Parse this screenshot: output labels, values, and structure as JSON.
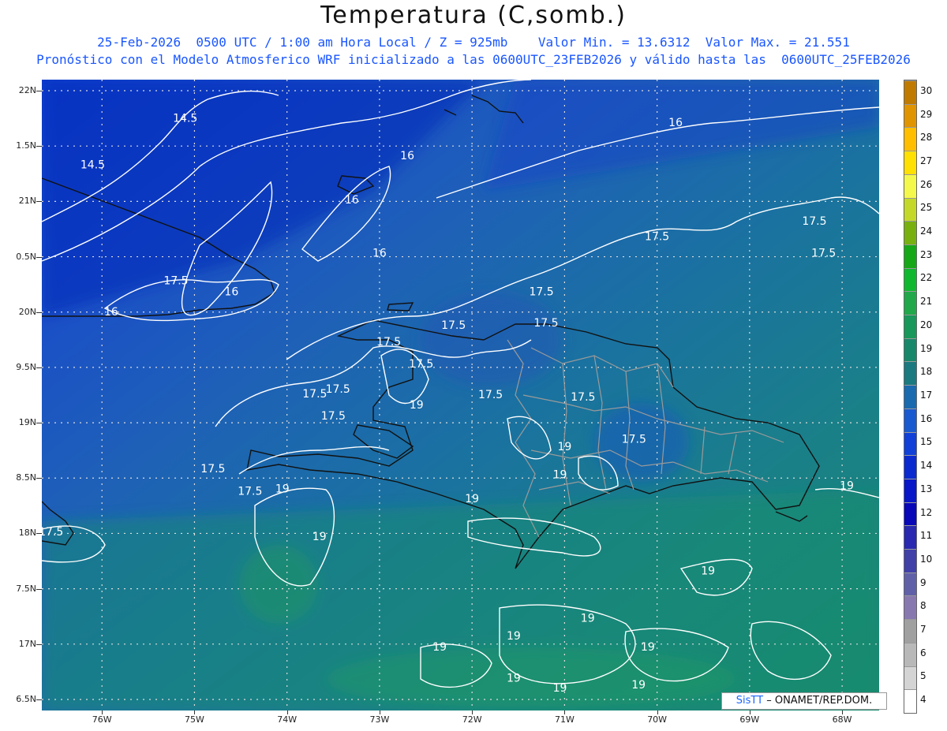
{
  "header": {
    "title": "Temperatura (C,somb.)",
    "line1": "25-Feb-2026  0500 UTC / 1:00 am Hora Local / Z = 925mb    Valor Min. = 13.6312  Valor Max. = 21.551",
    "line2": "Pronóstico con el Modelo Atmosferico WRF inicializado a las 0600UTC_23FEB2026 y válido hasta las  0600UTC_25FEB2026"
  },
  "axes": {
    "lat_labels": [
      "22N",
      "1.5N",
      "21N",
      "0.5N",
      "20N",
      "9.5N",
      "19N",
      "8.5N",
      "18N",
      "7.5N",
      "17N",
      "6.5N"
    ],
    "lat_values": [
      22,
      21.5,
      21,
      20.5,
      20,
      19.5,
      19,
      18.5,
      18,
      17.5,
      17,
      16.5
    ],
    "lon_labels": [
      "76W",
      "75W",
      "74W",
      "73W",
      "72W",
      "71W",
      "70W",
      "69W",
      "68W"
    ],
    "lon_values": [
      -76,
      -75,
      -74,
      -73,
      -72,
      -71,
      -70,
      -69,
      -68
    ],
    "lat_range": [
      16.4,
      22.1
    ],
    "lon_range": [
      -76.65,
      -67.6
    ]
  },
  "colorbar": {
    "labels": [
      "30",
      "29",
      "28",
      "27",
      "26",
      "25",
      "24",
      "23",
      "22",
      "21",
      "20",
      "19",
      "18",
      "17",
      "16",
      "15",
      "14",
      "13",
      "12",
      "11",
      "10",
      "9",
      "8",
      "7",
      "6",
      "5",
      "4"
    ],
    "colors": [
      "#c07a00",
      "#e09400",
      "#ffbe00",
      "#ffe000",
      "#f4f84a",
      "#c4d82a",
      "#78b010",
      "#16a816",
      "#10b830",
      "#20a84a",
      "#18985a",
      "#18886a",
      "#1a7a80",
      "#1a6ab0",
      "#1a5ad0",
      "#1040d8",
      "#0a2ad0",
      "#0818c8",
      "#0808b8",
      "#2828b0",
      "#4040a8",
      "#6060a8",
      "#8878b0",
      "#a0a0a0",
      "#b8b8b8",
      "#d4d4d4",
      "#ffffff"
    ]
  },
  "contours": {
    "labels": [
      {
        "text": "14.5",
        "lon": -75.1,
        "lat": 21.72
      },
      {
        "text": "14.5",
        "lon": -76.1,
        "lat": 21.3
      },
      {
        "text": "16",
        "lon": -73.3,
        "lat": 20.98
      },
      {
        "text": "16",
        "lon": -73.0,
        "lat": 20.5
      },
      {
        "text": "16",
        "lon": -74.6,
        "lat": 20.15
      },
      {
        "text": "16",
        "lon": -75.9,
        "lat": 19.97
      },
      {
        "text": "16",
        "lon": -72.7,
        "lat": 21.38
      },
      {
        "text": "16",
        "lon": -69.8,
        "lat": 21.68
      },
      {
        "text": "17.5",
        "lon": -70.0,
        "lat": 20.65
      },
      {
        "text": "17.5",
        "lon": -68.2,
        "lat": 20.5
      },
      {
        "text": "17.5",
        "lon": -68.3,
        "lat": 20.79
      },
      {
        "text": "17.5",
        "lon": -75.2,
        "lat": 20.25
      },
      {
        "text": "17.5",
        "lon": -71.25,
        "lat": 20.15
      },
      {
        "text": "17.5",
        "lon": -71.2,
        "lat": 19.87
      },
      {
        "text": "17.5",
        "lon": -72.2,
        "lat": 19.85
      },
      {
        "text": "17.5",
        "lon": -72.9,
        "lat": 19.7
      },
      {
        "text": "17.5",
        "lon": -72.55,
        "lat": 19.5
      },
      {
        "text": "17.5",
        "lon": -73.7,
        "lat": 19.23
      },
      {
        "text": "17.5",
        "lon": -73.45,
        "lat": 19.27
      },
      {
        "text": "17.5",
        "lon": -73.5,
        "lat": 19.03
      },
      {
        "text": "17.5",
        "lon": -71.8,
        "lat": 19.22
      },
      {
        "text": "17.5",
        "lon": -70.8,
        "lat": 19.2
      },
      {
        "text": "17.5",
        "lon": -70.25,
        "lat": 18.82
      },
      {
        "text": "17.5",
        "lon": -74.8,
        "lat": 18.55
      },
      {
        "text": "17.5",
        "lon": -74.4,
        "lat": 18.35
      },
      {
        "text": "17.5",
        "lon": -76.55,
        "lat": 17.98
      },
      {
        "text": "19",
        "lon": -72.6,
        "lat": 19.13
      },
      {
        "text": "19",
        "lon": -74.05,
        "lat": 18.37
      },
      {
        "text": "19",
        "lon": -71.0,
        "lat": 18.75
      },
      {
        "text": "19",
        "lon": -71.05,
        "lat": 18.5
      },
      {
        "text": "19",
        "lon": -72.0,
        "lat": 18.28
      },
      {
        "text": "19",
        "lon": -73.65,
        "lat": 17.94
      },
      {
        "text": "19",
        "lon": -67.95,
        "lat": 18.4
      },
      {
        "text": "19",
        "lon": -69.45,
        "lat": 17.63
      },
      {
        "text": "19",
        "lon": -70.75,
        "lat": 17.2
      },
      {
        "text": "19",
        "lon": -71.55,
        "lat": 17.04
      },
      {
        "text": "19",
        "lon": -72.35,
        "lat": 16.94
      },
      {
        "text": "19",
        "lon": -70.1,
        "lat": 16.94
      },
      {
        "text": "19",
        "lon": -71.55,
        "lat": 16.66
      },
      {
        "text": "19",
        "lon": -71.05,
        "lat": 16.57
      },
      {
        "text": "19",
        "lon": -70.2,
        "lat": 16.6
      }
    ]
  },
  "credit": {
    "brand": "SisTT",
    "text": "– ONAMET/REP.DOM."
  }
}
